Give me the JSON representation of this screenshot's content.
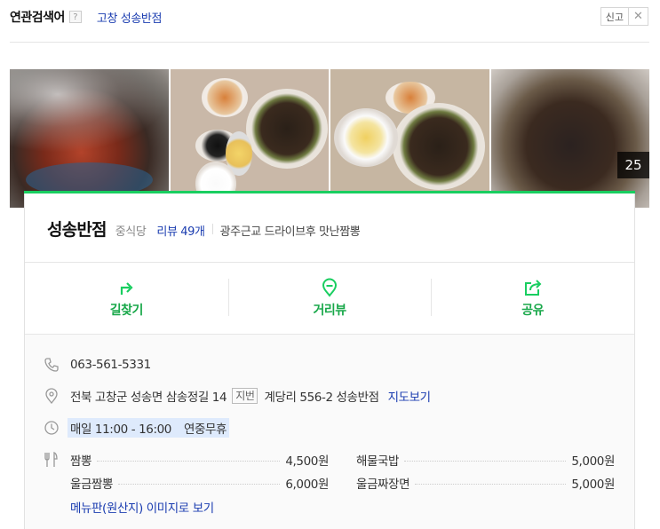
{
  "related": {
    "title": "연관검색어",
    "help_icon": "?",
    "keyword": "고창 성송반점",
    "report_label": "신고",
    "close_glyph": "✕"
  },
  "photos": {
    "count": "25"
  },
  "place": {
    "name": "성송반점",
    "category": "중식당",
    "review": "리뷰 49개",
    "description": "광주근교 드라이브후 맛난짬뽕"
  },
  "actions": [
    {
      "label": "길찾기",
      "icon": "directions-icon"
    },
    {
      "label": "거리뷰",
      "icon": "streetview-icon"
    },
    {
      "label": "공유",
      "icon": "share-icon"
    }
  ],
  "info": {
    "phone": "063-561-5331",
    "address": "전북 고창군 성송면 삼송정길 14",
    "jibun_tag": "지번",
    "jibun": "계당리 556-2 성송반점",
    "map_link": "지도보기",
    "hours": "매일 11:00 - 16:00",
    "holiday": "연중무휴"
  },
  "menu": {
    "left": [
      {
        "name": "짬뽕",
        "price": "4,500원"
      },
      {
        "name": "울금짬뽕",
        "price": "6,000원"
      }
    ],
    "right": [
      {
        "name": "해물국밥",
        "price": "5,000원"
      },
      {
        "name": "울금짜장면",
        "price": "5,000원"
      }
    ],
    "more_link": "메뉴판(원산지) 이미지로 보기"
  },
  "colors": {
    "accent_green": "#19ce60",
    "link_blue": "#1a3cb0"
  }
}
